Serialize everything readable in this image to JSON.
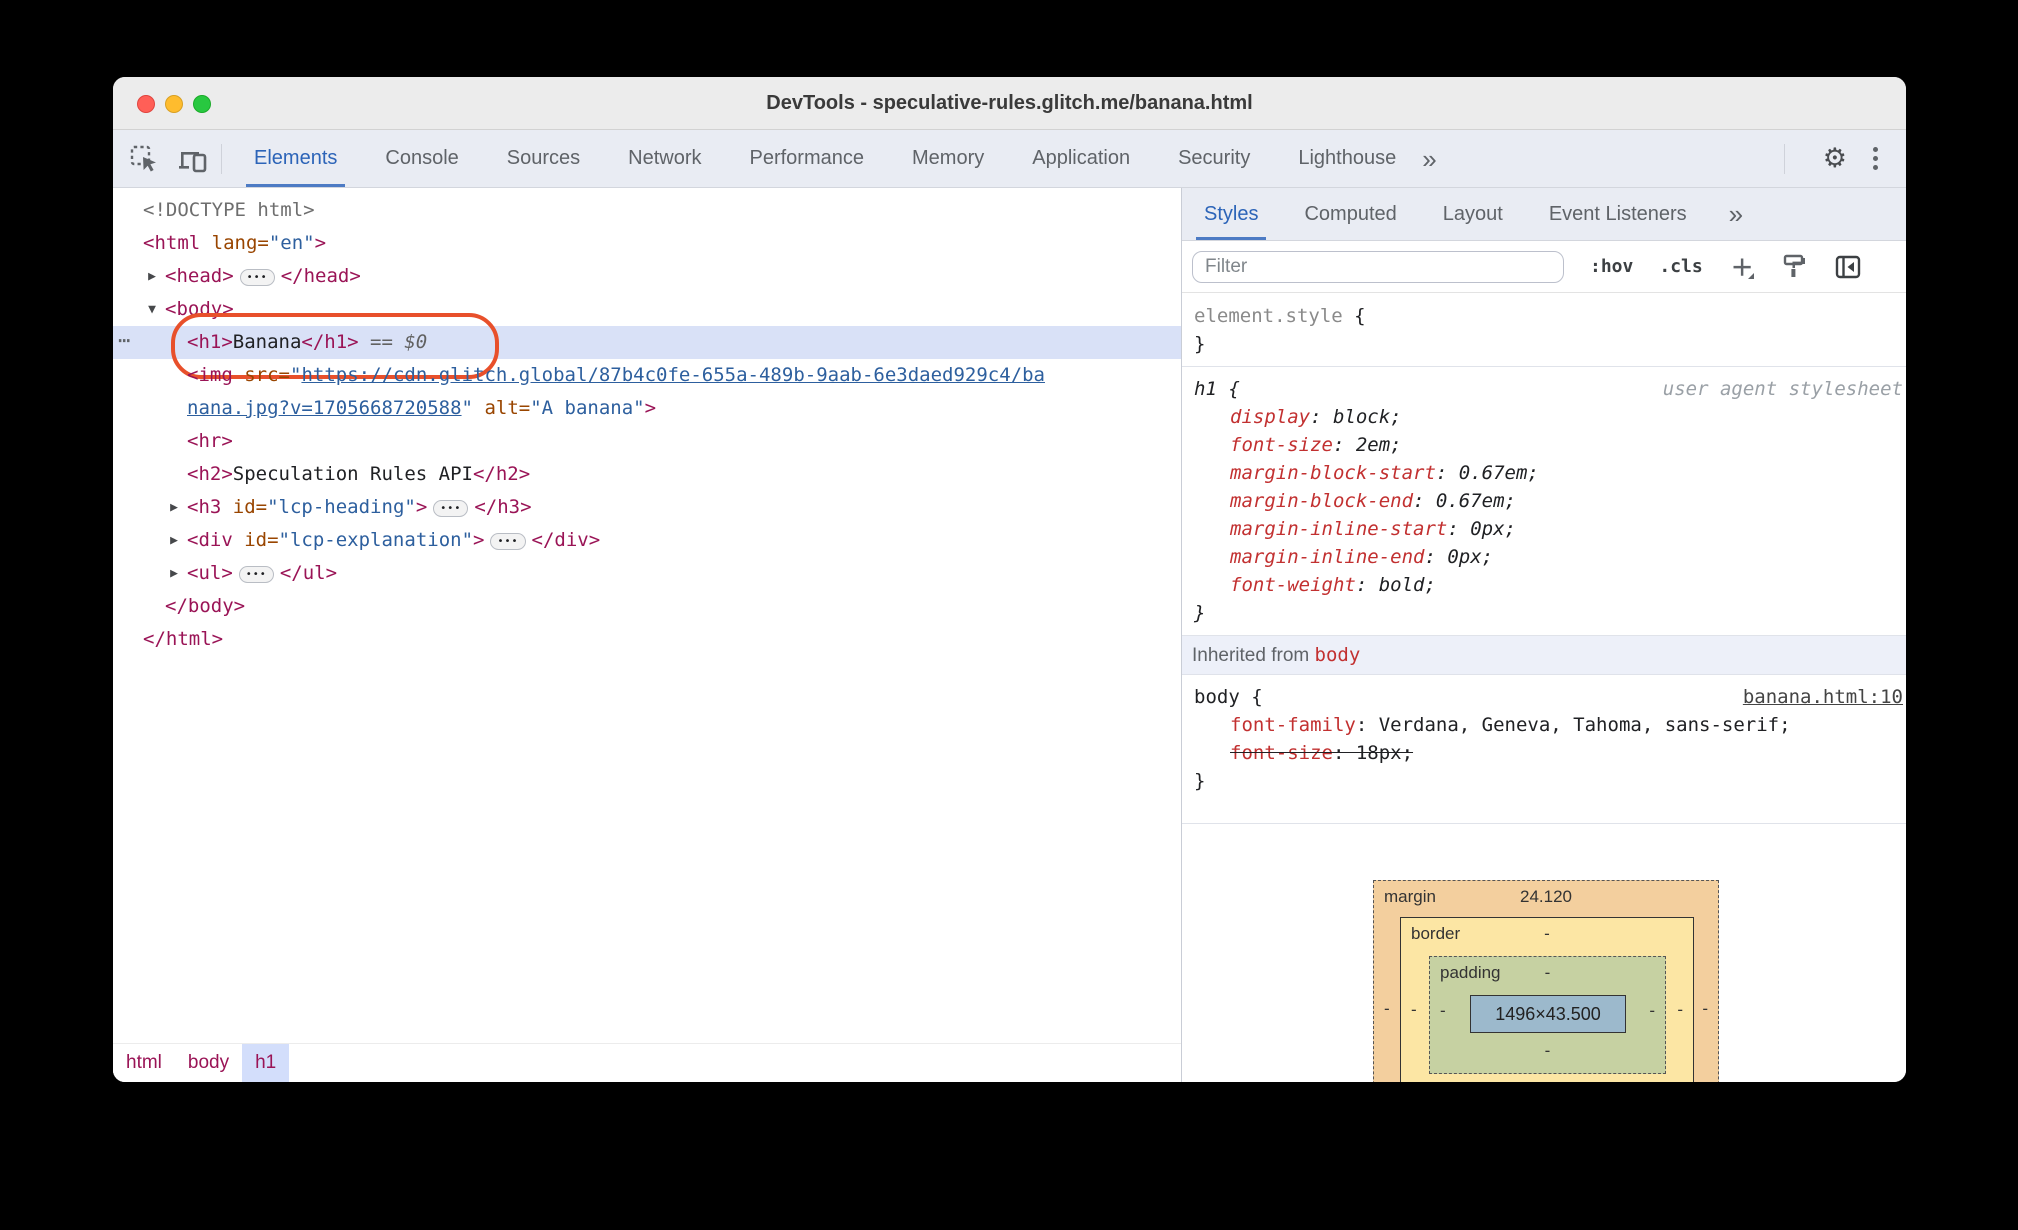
{
  "window": {
    "title": "DevTools - speculative-rules.glitch.me/banana.html"
  },
  "toolbar": {
    "tabs": [
      {
        "label": "Elements",
        "active": true
      },
      {
        "label": "Console"
      },
      {
        "label": "Sources"
      },
      {
        "label": "Network"
      },
      {
        "label": "Performance"
      },
      {
        "label": "Memory"
      },
      {
        "label": "Application"
      },
      {
        "label": "Security"
      },
      {
        "label": "Lighthouse"
      }
    ],
    "overflow_glyph": "»"
  },
  "elements_panel": {
    "tree": [
      {
        "indent": 0,
        "tokens": [
          {
            "c": "gray",
            "s": "<!DOCTYPE html>"
          }
        ]
      },
      {
        "indent": 0,
        "tokens": [
          {
            "c": "tag",
            "s": "<html"
          },
          {
            "c": "attr",
            "s": " lang"
          },
          {
            "c": "attr",
            "s": "="
          },
          {
            "c": "val",
            "s": "\"en\""
          },
          {
            "c": "tag",
            "s": ">"
          }
        ]
      },
      {
        "indent": 1,
        "arrow": "▶",
        "tokens": [
          {
            "c": "tag",
            "s": "<head>"
          },
          {
            "c": "pill"
          },
          {
            "c": "tag",
            "s": "</head>"
          }
        ]
      },
      {
        "indent": 1,
        "arrow": "▼",
        "tokens": [
          {
            "c": "tag",
            "s": "<body>"
          }
        ]
      },
      {
        "indent": 2,
        "selected": true,
        "dots": true,
        "oval": true,
        "tokens": [
          {
            "c": "tag",
            "s": "<h1>"
          },
          {
            "c": "text",
            "s": "Banana"
          },
          {
            "c": "tag",
            "s": "</h1>"
          },
          {
            "c": "eq",
            "s": " == $0"
          }
        ]
      },
      {
        "indent": 2,
        "tokens": [
          {
            "c": "tag",
            "s": "<img"
          },
          {
            "c": "attr",
            "s": " src"
          },
          {
            "c": "attr",
            "s": "="
          },
          {
            "c": "val",
            "s": "\""
          },
          {
            "c": "link",
            "s": "https://cdn.glitch.global/87b4c0fe-655a-489b-9aab-6e3daed929c4/ba"
          }
        ]
      },
      {
        "indent": 2,
        "tokens": [
          {
            "c": "link",
            "s": "nana.jpg?v=1705668720588"
          },
          {
            "c": "val",
            "s": "\""
          },
          {
            "c": "attr",
            "s": " alt"
          },
          {
            "c": "attr",
            "s": "="
          },
          {
            "c": "val",
            "s": "\"A banana\""
          },
          {
            "c": "tag",
            "s": ">"
          }
        ]
      },
      {
        "indent": 2,
        "tokens": [
          {
            "c": "tag",
            "s": "<hr>"
          }
        ]
      },
      {
        "indent": 2,
        "tokens": [
          {
            "c": "tag",
            "s": "<h2>"
          },
          {
            "c": "text",
            "s": "Speculation Rules API"
          },
          {
            "c": "tag",
            "s": "</h2>"
          }
        ]
      },
      {
        "indent": 2,
        "arrow": "▶",
        "tokens": [
          {
            "c": "tag",
            "s": "<h3"
          },
          {
            "c": "attr",
            "s": " id"
          },
          {
            "c": "attr",
            "s": "="
          },
          {
            "c": "val",
            "s": "\"lcp-heading\""
          },
          {
            "c": "tag",
            "s": ">"
          },
          {
            "c": "pill"
          },
          {
            "c": "tag",
            "s": "</h3>"
          }
        ]
      },
      {
        "indent": 2,
        "arrow": "▶",
        "tokens": [
          {
            "c": "tag",
            "s": "<div"
          },
          {
            "c": "attr",
            "s": " id"
          },
          {
            "c": "attr",
            "s": "="
          },
          {
            "c": "val",
            "s": "\"lcp-explanation\""
          },
          {
            "c": "tag",
            "s": ">"
          },
          {
            "c": "pill"
          },
          {
            "c": "tag",
            "s": "</div>"
          }
        ]
      },
      {
        "indent": 2,
        "arrow": "▶",
        "tokens": [
          {
            "c": "tag",
            "s": "<ul>"
          },
          {
            "c": "pill"
          },
          {
            "c": "tag",
            "s": "</ul>"
          }
        ]
      },
      {
        "indent": 1,
        "tokens": [
          {
            "c": "tag",
            "s": "</body>"
          }
        ]
      },
      {
        "indent": 0,
        "tokens": [
          {
            "c": "tag",
            "s": "</html>"
          }
        ]
      }
    ],
    "breadcrumbs": [
      {
        "label": "html"
      },
      {
        "label": "body"
      },
      {
        "label": "h1",
        "selected": true
      }
    ]
  },
  "styles_panel": {
    "tabs": [
      {
        "label": "Styles",
        "active": true
      },
      {
        "label": "Computed"
      },
      {
        "label": "Layout"
      },
      {
        "label": "Event Listeners"
      }
    ],
    "overflow_glyph": "»",
    "filter_placeholder": "Filter",
    "pseudo_toggle": ":hov",
    "class_toggle": ".cls",
    "brace_open": "{",
    "brace_close": "}",
    "element_style": {
      "selector": "element.style"
    },
    "ua_rule": {
      "selector": "h1",
      "origin": "user agent stylesheet",
      "properties": [
        {
          "name": "display",
          "value": "block"
        },
        {
          "name": "font-size",
          "value": "2em"
        },
        {
          "name": "margin-block-start",
          "value": "0.67em"
        },
        {
          "name": "margin-block-end",
          "value": "0.67em"
        },
        {
          "name": "margin-inline-start",
          "value": "0px"
        },
        {
          "name": "margin-inline-end",
          "value": "0px"
        },
        {
          "name": "font-weight",
          "value": "bold"
        }
      ]
    },
    "inherited": {
      "label": "Inherited from ",
      "node": "body"
    },
    "body_rule": {
      "selector": "body",
      "source": "banana.html:10",
      "properties": [
        {
          "name": "font-family",
          "value": "Verdana, Geneva, Tahoma, sans-serif"
        },
        {
          "name": "font-size",
          "value": "18px",
          "overridden": true
        }
      ]
    },
    "box_model": {
      "margin_label": "margin",
      "margin_top": "24.120",
      "border_label": "border",
      "border_top": "-",
      "padding_label": "padding",
      "padding_top": "-",
      "content": "1496×43.500",
      "left_values": [
        "-",
        "-",
        "-"
      ],
      "right_values": [
        "-",
        "-",
        "-"
      ],
      "bottom_values": [
        "-",
        "-"
      ]
    }
  }
}
